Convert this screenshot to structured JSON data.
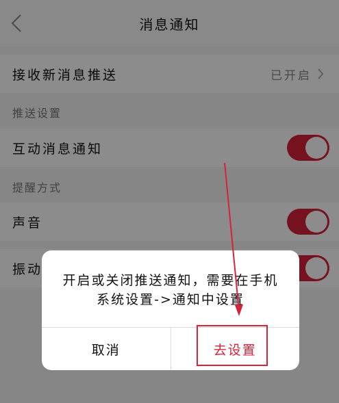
{
  "header": {
    "title": "消息通知",
    "back_icon": "chevron-left-icon"
  },
  "settings": {
    "receive_push": {
      "label": "接收新消息推送",
      "value": "已开启"
    },
    "push_section_label": "推送设置",
    "interactive_notify": {
      "label": "互动消息通知",
      "enabled": true
    },
    "reminder_section_label": "提醒方式",
    "sound": {
      "label": "声音",
      "enabled": true
    },
    "vibrate": {
      "label": "振动",
      "enabled": true
    }
  },
  "dialog": {
    "message": "开启或关闭推送通知，需要在手机系统设置->通知中设置",
    "cancel_label": "取消",
    "confirm_label": "去设置"
  },
  "colors": {
    "accent": "#d8223a",
    "annotation": "#d8223a"
  }
}
